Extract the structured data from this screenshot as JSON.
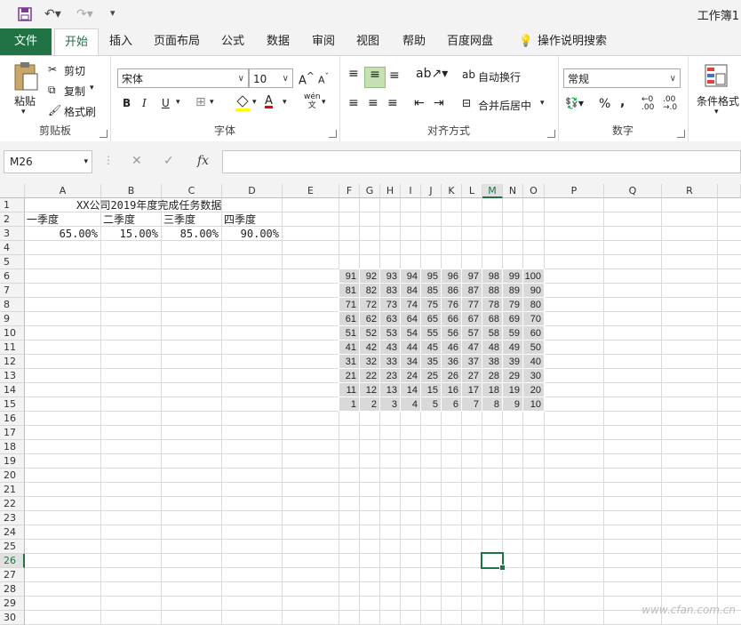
{
  "window": {
    "title": "工作簿1"
  },
  "quick_access": {
    "save_icon": "save-icon",
    "undo_icon": "undo-icon",
    "redo_icon": "redo-icon",
    "customize_icon": "customize-icon"
  },
  "tabs": [
    {
      "label": "文件"
    },
    {
      "label": "开始"
    },
    {
      "label": "插入"
    },
    {
      "label": "页面布局"
    },
    {
      "label": "公式"
    },
    {
      "label": "数据"
    },
    {
      "label": "审阅"
    },
    {
      "label": "视图"
    },
    {
      "label": "帮助"
    },
    {
      "label": "百度网盘"
    }
  ],
  "tell_me": "操作说明搜索",
  "ribbon": {
    "clipboard": {
      "paste": "粘贴",
      "cut": "剪切",
      "copy": "复制",
      "format_painter": "格式刷",
      "label": "剪贴板"
    },
    "font": {
      "name": "宋体",
      "size": "10",
      "bold": "B",
      "italic": "I",
      "underline": "U",
      "label": "字体",
      "grow": "A",
      "shrink": "A",
      "font_color_glyph": "A",
      "phonetic": "wén\n文"
    },
    "alignment": {
      "wrap": "自动换行",
      "merge": "合并后居中",
      "label": "对齐方式"
    },
    "number": {
      "format": "常规",
      "percent": "%",
      "comma": ",",
      "label": "数字"
    },
    "styles": {
      "conditional": "条件格式"
    }
  },
  "formula_bar": {
    "name_box": "M26",
    "fx": "fx",
    "value": ""
  },
  "columns": [
    "A",
    "B",
    "C",
    "D",
    "E",
    "F",
    "G",
    "H",
    "I",
    "J",
    "K",
    "L",
    "M",
    "N",
    "O",
    "P",
    "Q",
    "R"
  ],
  "rows": [
    "1",
    "2",
    "3",
    "4",
    "5",
    "6",
    "7",
    "8",
    "9",
    "10",
    "11",
    "12",
    "13",
    "14",
    "15",
    "16",
    "17",
    "18",
    "19",
    "20",
    "21",
    "22",
    "23",
    "24",
    "25",
    "26",
    "27",
    "28",
    "29",
    "30"
  ],
  "cells": {
    "title": "XX公司2019年度完成任务数据",
    "headers": [
      "一季度",
      "二季度",
      "三季度",
      "四季度"
    ],
    "values": [
      "65.00%",
      "15.00%",
      "85.00%",
      "90.00%"
    ]
  },
  "number_grid": [
    [
      91,
      92,
      93,
      94,
      95,
      96,
      97,
      98,
      99,
      100
    ],
    [
      81,
      82,
      83,
      84,
      85,
      86,
      87,
      88,
      89,
      90
    ],
    [
      71,
      72,
      73,
      74,
      75,
      76,
      77,
      78,
      79,
      80
    ],
    [
      61,
      62,
      63,
      64,
      65,
      66,
      67,
      68,
      69,
      70
    ],
    [
      51,
      52,
      53,
      54,
      55,
      56,
      57,
      58,
      59,
      60
    ],
    [
      41,
      42,
      43,
      44,
      45,
      46,
      47,
      48,
      49,
      50
    ],
    [
      31,
      32,
      33,
      34,
      35,
      36,
      37,
      38,
      39,
      40
    ],
    [
      21,
      22,
      23,
      24,
      25,
      26,
      27,
      28,
      29,
      30
    ],
    [
      11,
      12,
      13,
      14,
      15,
      16,
      17,
      18,
      19,
      20
    ],
    [
      1,
      2,
      3,
      4,
      5,
      6,
      7,
      8,
      9,
      10
    ]
  ],
  "watermark": "www.cfan.com.cn",
  "colors": {
    "accent": "#217346",
    "shade": "#d9d9d9"
  }
}
